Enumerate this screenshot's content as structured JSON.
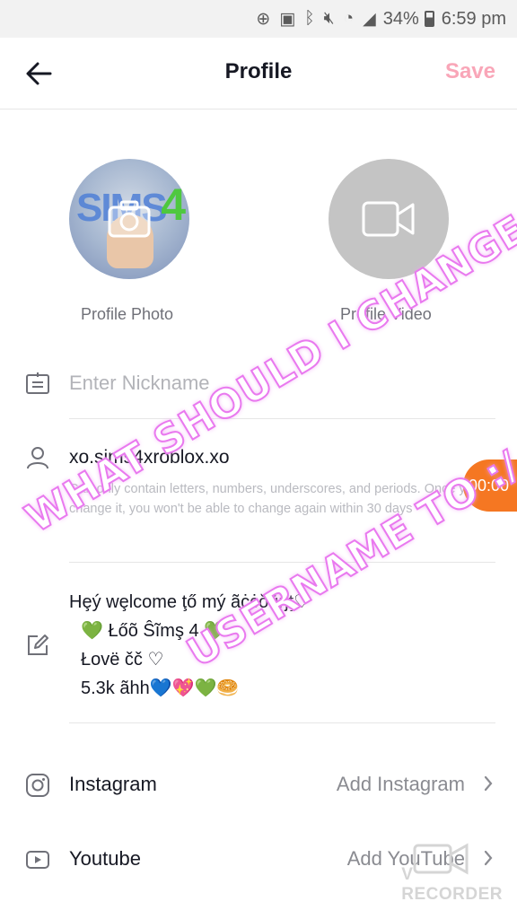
{
  "statusbar": {
    "battery_percent": "34%",
    "time": "6:59 pm",
    "icons": [
      "add-circle-icon",
      "cast-icon",
      "bluetooth-icon",
      "mute-icon",
      "wifi-icon",
      "signal-icon",
      "battery-icon"
    ]
  },
  "header": {
    "title": "Profile",
    "save_label": "Save",
    "save_color": "#f9a6b8"
  },
  "media": {
    "photo_label": "Profile Photo",
    "video_label": "Profile Video",
    "photo_graphic_text": "SIMS",
    "photo_graphic_number": "4"
  },
  "nickname": {
    "placeholder": "Enter Nickname",
    "value": ""
  },
  "username": {
    "value": "xo.sims4xroblox.xo",
    "hint": "Can only contain letters, numbers, underscores, and periods. Once you change it, you won't be able to change again within 30 days"
  },
  "recording_timer": "00:00",
  "bio": {
    "lines": [
      "Hȩý wȩlcome ţő mý ãċċŏūŋţ♡",
      "💚 Łőõ Ŝĩmş 4 💚",
      "Łovë čč ♡",
      "5.3k ãhh💙💖💚🥯"
    ]
  },
  "social": {
    "instagram": {
      "label": "Instagram",
      "action": "Add Instagram"
    },
    "youtube": {
      "label": "Youtube",
      "action": "Add YouTube"
    }
  },
  "overlay_text": {
    "line1": "WHAT SHOULD I CHANGE MY",
    "line2": "USERNAME TO :/"
  },
  "watermark": "V RECORDER",
  "colors": {
    "accent_pink": "#f9a6b8",
    "timer_orange": "#f57722",
    "overlay_stroke": "#e979ef"
  }
}
